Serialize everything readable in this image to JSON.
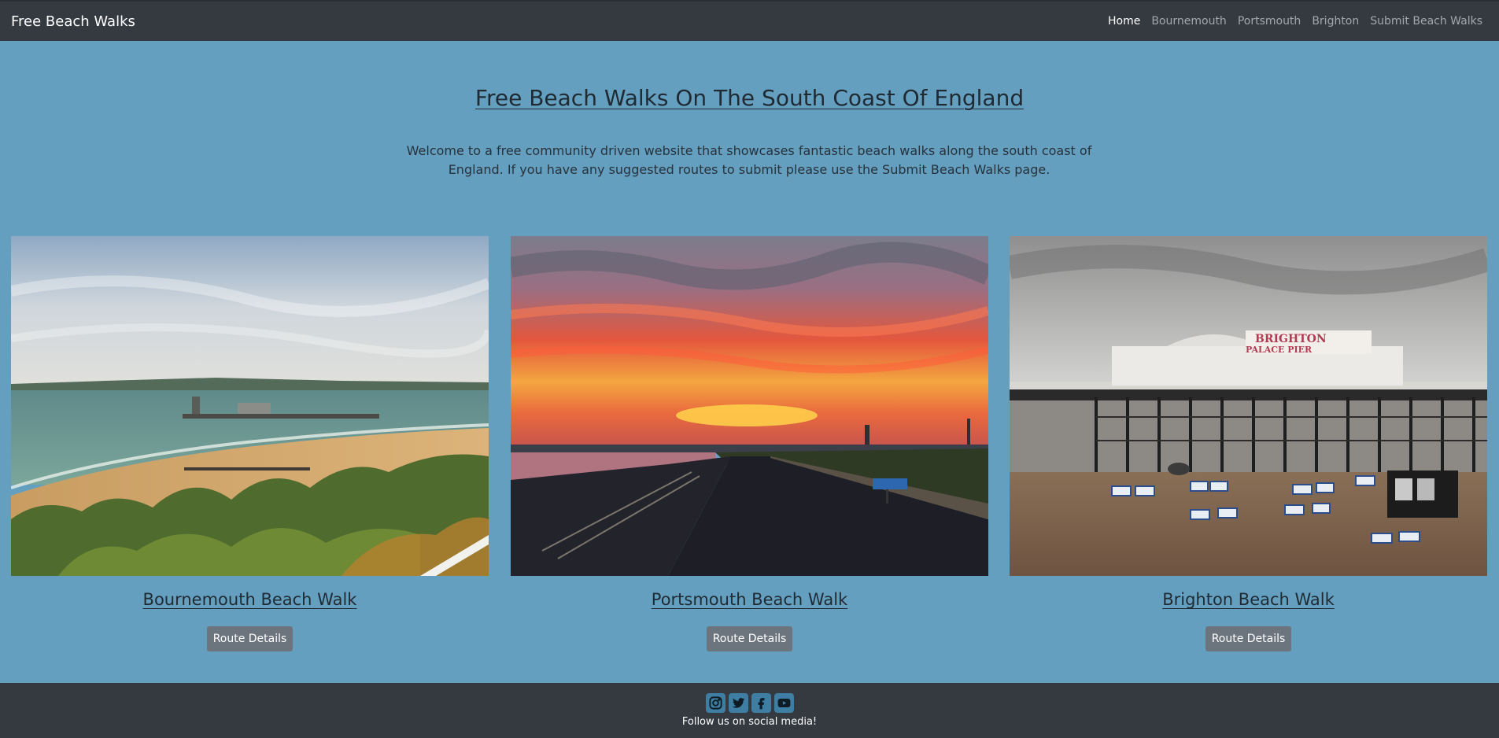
{
  "navbar": {
    "brand": "Free Beach Walks",
    "links": [
      {
        "label": "Home",
        "active": true
      },
      {
        "label": "Bournemouth",
        "active": false
      },
      {
        "label": "Portsmouth",
        "active": false
      },
      {
        "label": "Brighton",
        "active": false
      },
      {
        "label": "Submit Beach Walks",
        "active": false
      }
    ]
  },
  "hero": {
    "title": "Free Beach Walks On The South Coast Of England",
    "intro": "Welcome to a free community driven website that showcases fantastic beach walks along the south coast of England. If you have any suggested routes to submit please use the Submit Beach Walks page."
  },
  "cards": [
    {
      "title": "Bournemouth Beach Walk",
      "button": "Route Details"
    },
    {
      "title": "Portsmouth Beach Walk",
      "button": "Route Details"
    },
    {
      "title": "Brighton Beach Walk",
      "button": "Route Details"
    }
  ],
  "footer": {
    "icons": [
      "instagram-icon",
      "twitter-icon",
      "facebook-icon",
      "youtube-icon"
    ],
    "text": "Follow us on social media!"
  },
  "colors": {
    "page_background": "#649fbf",
    "navbar_background": "#343a40",
    "button_background": "#6c757d",
    "social_icon_background": "#3f7ea3"
  }
}
